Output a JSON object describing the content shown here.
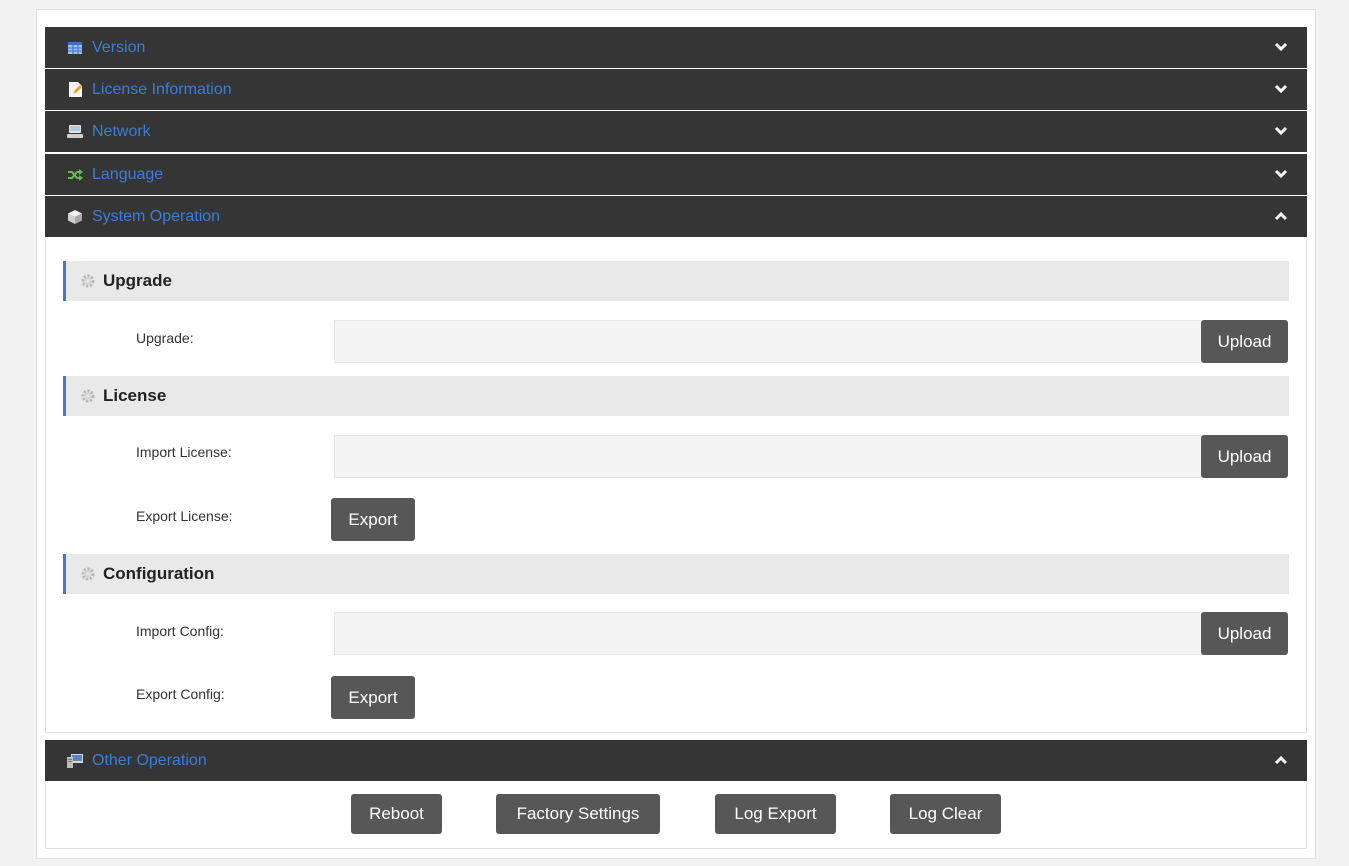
{
  "accordion": {
    "version": {
      "title": "Version",
      "icon": "table-icon"
    },
    "license_info": {
      "title": "License Information",
      "icon": "document-icon"
    },
    "network": {
      "title": "Network",
      "icon": "network-icon"
    },
    "language": {
      "title": "Language",
      "icon": "shuffle-icon"
    },
    "system_operation": {
      "title": "System Operation",
      "icon": "cube-icon"
    },
    "other_operation": {
      "title": "Other Operation",
      "icon": "monitor-icon"
    }
  },
  "system_operation": {
    "upgrade": {
      "section_title": "Upgrade",
      "row_label": "Upgrade:",
      "input_value": "",
      "upload_label": "Upload"
    },
    "license": {
      "section_title": "License",
      "import_label": "Import License:",
      "import_value": "",
      "upload_label": "Upload",
      "export_label": "Export License:",
      "export_button": "Export"
    },
    "configuration": {
      "section_title": "Configuration",
      "import_label": "Import Config:",
      "import_value": "",
      "upload_label": "Upload",
      "export_label": "Export Config:",
      "export_button": "Export"
    }
  },
  "other_operation": {
    "reboot": "Reboot",
    "factory_settings": "Factory Settings",
    "log_export": "Log Export",
    "log_clear": "Log Clear"
  },
  "colors": {
    "header_bg": "#353535",
    "header_text": "#3b7dd8",
    "button_bg": "#575757",
    "section_accent": "#4a78b9"
  }
}
